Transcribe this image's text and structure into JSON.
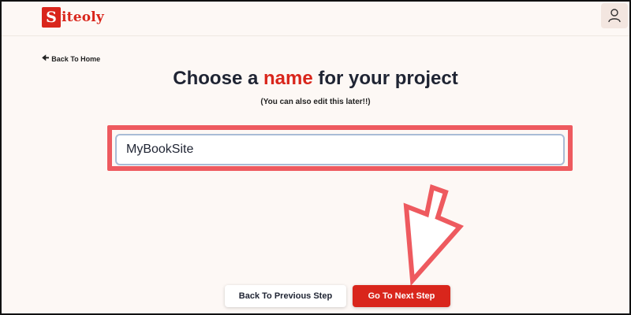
{
  "header": {
    "logo_letter": "S",
    "logo_rest": "iteoly",
    "user_icon": "user-icon"
  },
  "nav": {
    "back_home_icon": "arrow-left-icon",
    "back_home_label": "Back To Home"
  },
  "main": {
    "title_before": "Choose a",
    "title_accent": "name",
    "title_after": "for your project",
    "subtitle": "(You can also edit this later!!)",
    "project_name_value": "MyBookSite"
  },
  "footer": {
    "prev_label": "Back To Previous Step",
    "next_label": "Go To Next Step"
  },
  "colors": {
    "brand": "#d9261c",
    "highlight": "#ee5a5f",
    "background": "#fdf8f5"
  }
}
